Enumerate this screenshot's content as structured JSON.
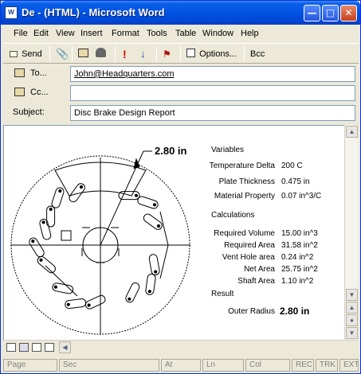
{
  "window": {
    "icon": "W",
    "title": "De - (HTML) - Microsoft Word",
    "buttons": [
      "minimize",
      "maximize",
      "close"
    ]
  },
  "menu": [
    "File",
    "Edit",
    "View",
    "Insert",
    "Format",
    "Tools",
    "Table",
    "Window",
    "Help"
  ],
  "toolbar": {
    "send_label": "Send",
    "options_label": "Options...",
    "bcc_label": "Bcc"
  },
  "fields": {
    "to_label": "To...",
    "to_value": "John@Headquarters.com",
    "cc_label": "Cc...",
    "cc_value": "",
    "subject_label": "Subject:",
    "subject_value": "Disc Brake Design Report"
  },
  "report": {
    "drawing_label": "2.80 in",
    "variables_heading": "Variables",
    "variables": [
      {
        "label": "Temperature Delta",
        "value": "200 C"
      },
      {
        "label": "Plate Thickness",
        "value": "0.475 in"
      },
      {
        "label": "Material Property",
        "value": "0.07 in^3/C"
      }
    ],
    "calculations_heading": "Calculations",
    "calculations": [
      {
        "label": "Required Volume",
        "value": "15.00 in^3"
      },
      {
        "label": "Required Area",
        "value": "31.58 in^2"
      },
      {
        "label": "Vent Hole area",
        "value": "0.24 in^2"
      },
      {
        "label": "Net Area",
        "value": "25.75 in^2"
      },
      {
        "label": "Shaft Area",
        "value": "1.10 in^2"
      }
    ],
    "result_heading": "Result",
    "result_label": "Outer Radius",
    "result_value": "2.80 in"
  },
  "status": {
    "page": "Page",
    "sec": "Sec",
    "at": "At",
    "ln": "Ln",
    "col": "Col",
    "rec": "REC",
    "trk": "TRK",
    "ext": "EXT"
  }
}
